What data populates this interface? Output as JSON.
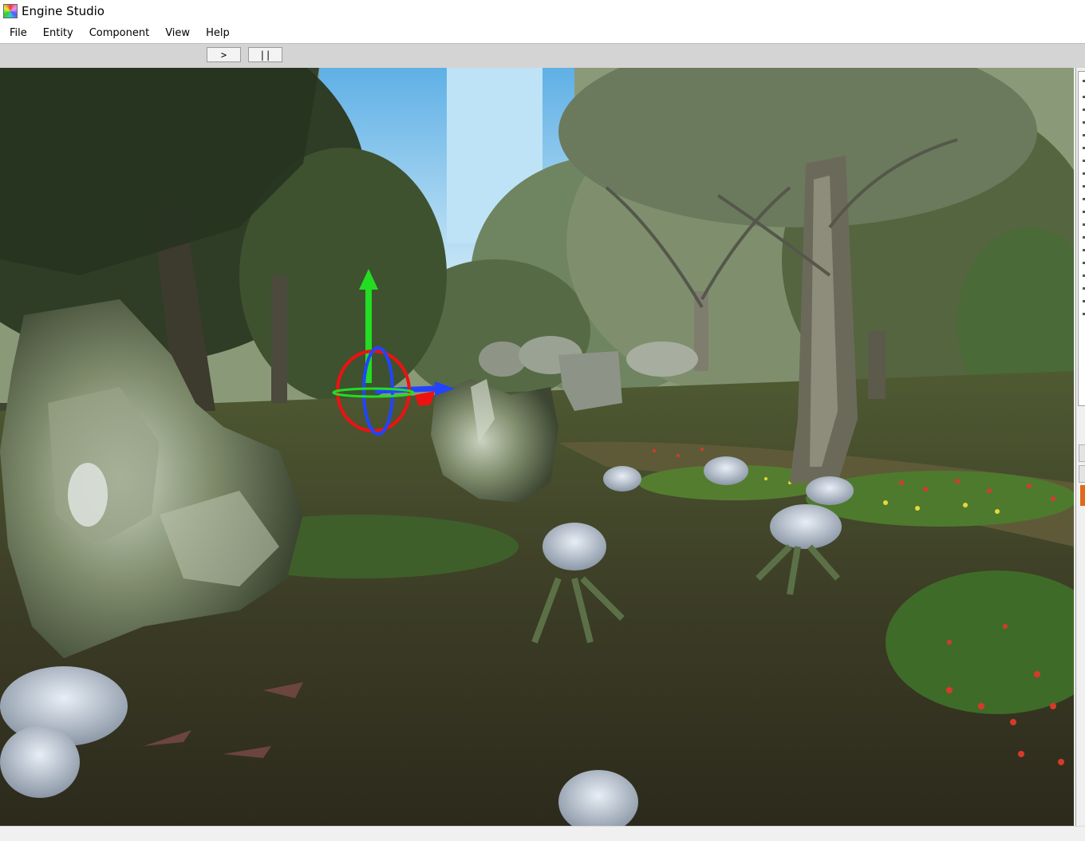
{
  "window": {
    "title": "Engine Studio",
    "icon": "engine-studio-app-icon"
  },
  "menu": {
    "items": [
      "File",
      "Entity",
      "Component",
      "View",
      "Help"
    ]
  },
  "toolbar": {
    "play_label": ">",
    "pause_label": "||"
  },
  "viewport": {
    "scene": "forest-scene",
    "gizmo": {
      "y_axis_color": "#22dd22",
      "x_axis_color": "#2244ff",
      "rotation_ring_color": "#ee1111"
    }
  },
  "colors": {
    "toolbar_bg": "#d4d4d4",
    "accent_orange": "#e06a1a"
  }
}
